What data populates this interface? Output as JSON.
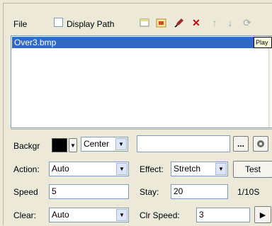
{
  "toolbar": {
    "file_label": "File",
    "display_path_label": "Display Path",
    "display_path_checked": false,
    "icons": [
      "new-icon",
      "open-image-icon",
      "pen-icon",
      "delete-icon",
      "move-up-icon",
      "move-down-icon",
      "refresh-icon"
    ]
  },
  "list": {
    "items": [
      "Over3.bmp"
    ],
    "selected_index": 0
  },
  "panel": {
    "background_label": "Backgr",
    "background_color": "#000000",
    "position_value": "Center",
    "path_value": "",
    "browse_label": "...",
    "action_label": "Action:",
    "action_value": "Auto",
    "effect_label": "Effect:",
    "effect_value": "Stretch",
    "test_label": "Test",
    "speed_label": "Speed",
    "speed_value": "5",
    "stay_label": "Stay:",
    "stay_value": "20",
    "stay_unit": "1/10S",
    "clear_label": "Clear:",
    "clear_value": "Auto",
    "clr_speed_label": "Clr Speed:",
    "clr_speed_value": "3",
    "play_label": "▶"
  },
  "tooltip": {
    "text": "Play"
  }
}
